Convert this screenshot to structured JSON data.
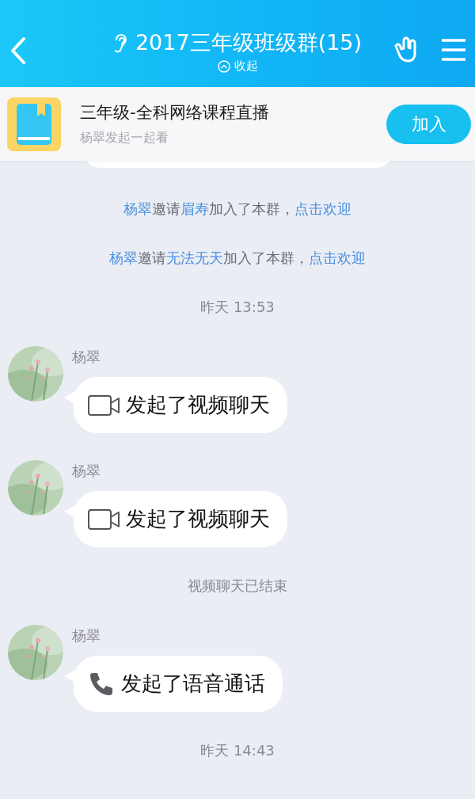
{
  "header": {
    "title": "2017三年级班级群(15)",
    "subtitle": "收起"
  },
  "banner": {
    "title": "三年级-全科网络课程直播",
    "subtitle": "杨翠发起一起看",
    "button": "加入"
  },
  "feed": [
    {
      "kind": "bubble_edge"
    },
    {
      "kind": "notice",
      "parts": [
        {
          "text": "杨翠",
          "link": true
        },
        {
          "text": "邀请",
          "link": false
        },
        {
          "text": "眉寿",
          "link": true
        },
        {
          "text": "加入了本群，",
          "link": false
        },
        {
          "text": "点击欢迎",
          "link": true
        }
      ]
    },
    {
      "kind": "notice",
      "parts": [
        {
          "text": "杨翠",
          "link": true
        },
        {
          "text": "邀请",
          "link": false
        },
        {
          "text": "无法无天",
          "link": true
        },
        {
          "text": "加入了本群，",
          "link": false
        },
        {
          "text": "点击欢迎",
          "link": true
        }
      ]
    },
    {
      "kind": "time",
      "text": "昨天 13:53"
    },
    {
      "kind": "video_call",
      "sender": "杨翠",
      "text": "发起了视频聊天"
    },
    {
      "kind": "video_call",
      "sender": "杨翠",
      "text": "发起了视频聊天"
    },
    {
      "kind": "time",
      "text": "视频聊天已结束"
    },
    {
      "kind": "voice_call",
      "sender": "杨翠",
      "text": "发起了语音通话"
    },
    {
      "kind": "time",
      "text": "昨天 14:43"
    }
  ]
}
